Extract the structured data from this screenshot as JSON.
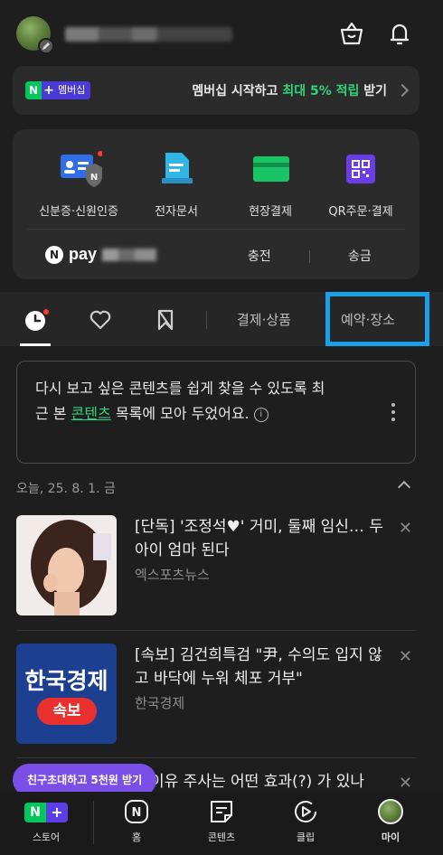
{
  "header": {
    "user_avatar": "avatar",
    "user_name_hidden": true,
    "shopping_icon": "shopping-bag-icon",
    "notification_icon": "bell-icon"
  },
  "membership": {
    "badge_n": "N",
    "badge_plus": "+",
    "badge_label": "멤버십",
    "text_before": "멤버십 시작하고 ",
    "text_highlight": "최대 5% 적립",
    "text_after": " 받기"
  },
  "services": {
    "items": [
      {
        "label": "신분증·신원인증",
        "icon": "id-card-icon"
      },
      {
        "label": "전자문서",
        "icon": "document-icon"
      },
      {
        "label": "현장결제",
        "icon": "card-payment-icon"
      },
      {
        "label": "QR주문·결제",
        "icon": "qr-code-icon"
      }
    ],
    "npay": {
      "circle": "N",
      "label": "pay"
    },
    "charge_label": "충전",
    "send_label": "송금"
  },
  "tabs": {
    "recent_icon": "clock-icon",
    "like_icon": "heart-icon",
    "bookmark_icon": "bookmark-icon",
    "payment_products": "결제·상품",
    "reservation_places": "예약·장소"
  },
  "infobox": {
    "text_1": "다시 보고 싶은 콘텐츠를 쉽게 찾을 수 있도록 최근 본 ",
    "link": "콘텐츠",
    "text_2": " 목록에 모아 두었어요."
  },
  "date_header": "오늘, 25. 8. 1. 금",
  "news": [
    {
      "title": "[단독] '조정석♥' 거미, 둘째 임신… 두 아이 엄마 된다",
      "source": "엑스포츠뉴스",
      "thumb_text": ""
    },
    {
      "title": "[속보] 김건희특검 \"尹, 수의도 입지 않고 바닥에 누워 체포 거부\"",
      "source": "한국경제",
      "thumb_text_top": "한국경제",
      "thumb_text_badge": "속보"
    },
    {
      "title": "이유 주사는 어떤 효과(?) 가 있나",
      "source": ""
    }
  ],
  "invite_label": "친구초대하고 5천원 받기",
  "bottom_nav": [
    {
      "label": "스토어",
      "icon": "store-icon"
    },
    {
      "label": "홈",
      "icon": "home-icon"
    },
    {
      "label": "콘텐츠",
      "icon": "contents-icon"
    },
    {
      "label": "클립",
      "icon": "clip-icon"
    },
    {
      "label": "마이",
      "icon": "my-avatar-icon"
    }
  ],
  "colors": {
    "background": "#1e1e1e",
    "card": "#2b2b2b",
    "accent_green": "#2ed37a",
    "naver_green": "#03c75a",
    "highlight_blue": "#1aa0e6",
    "purple": "#7b4ee8"
  }
}
